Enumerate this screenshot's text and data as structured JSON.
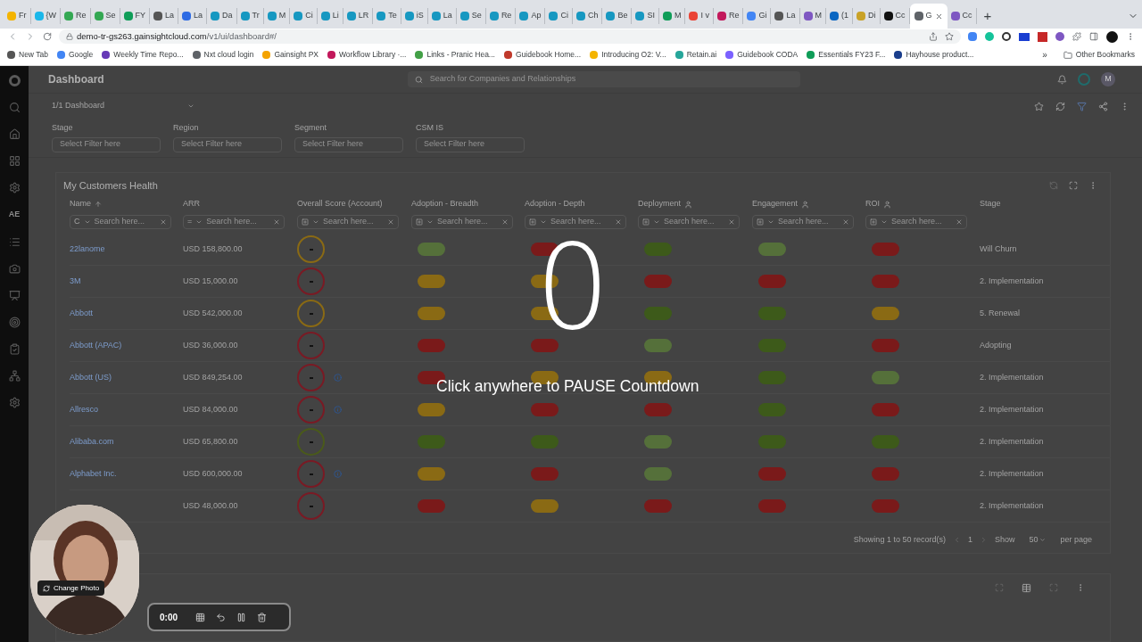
{
  "browser": {
    "tabs": [
      {
        "title": "Fr",
        "color": "#f4b400",
        "selected": false
      },
      {
        "title": "{W",
        "color": "#1ab7ea",
        "selected": false
      },
      {
        "title": "Re",
        "color": "#34a853",
        "selected": false
      },
      {
        "title": "Se",
        "color": "#34a853",
        "selected": false
      },
      {
        "title": "FY",
        "color": "#0f9d58",
        "selected": false
      },
      {
        "title": "La",
        "color": "#555555",
        "selected": false
      },
      {
        "title": "La",
        "color": "#2d6be4",
        "selected": false
      },
      {
        "title": "Da",
        "color": "#1798c1",
        "selected": false
      },
      {
        "title": "Tr",
        "color": "#1798c1",
        "selected": false
      },
      {
        "title": "M",
        "color": "#1798c1",
        "selected": false
      },
      {
        "title": "Ci",
        "color": "#1798c1",
        "selected": false
      },
      {
        "title": "Li",
        "color": "#1798c1",
        "selected": false
      },
      {
        "title": "LR",
        "color": "#1798c1",
        "selected": false
      },
      {
        "title": "Te",
        "color": "#1798c1",
        "selected": false
      },
      {
        "title": "iS",
        "color": "#1798c1",
        "selected": false
      },
      {
        "title": "La",
        "color": "#1798c1",
        "selected": false
      },
      {
        "title": "Se",
        "color": "#1798c1",
        "selected": false
      },
      {
        "title": "Re",
        "color": "#1798c1",
        "selected": false
      },
      {
        "title": "Ap",
        "color": "#1798c1",
        "selected": false
      },
      {
        "title": "Ci",
        "color": "#1798c1",
        "selected": false
      },
      {
        "title": "Ch",
        "color": "#1798c1",
        "selected": false
      },
      {
        "title": "Be",
        "color": "#1798c1",
        "selected": false
      },
      {
        "title": "SI",
        "color": "#1798c1",
        "selected": false
      },
      {
        "title": "M",
        "color": "#0f9d58",
        "selected": false
      },
      {
        "title": "I v",
        "color": "#ea4335",
        "selected": false
      },
      {
        "title": "Re",
        "color": "#c2185b",
        "selected": false
      },
      {
        "title": "Gi",
        "color": "#4285f4",
        "selected": false
      },
      {
        "title": "La",
        "color": "#555555",
        "selected": false
      },
      {
        "title": "M",
        "color": "#7e57c2",
        "selected": false
      },
      {
        "title": "(1",
        "color": "#0a66c2",
        "selected": false
      },
      {
        "title": "Di",
        "color": "#c9a227",
        "selected": false
      },
      {
        "title": "Cc",
        "color": "#111111",
        "selected": false
      },
      {
        "title": "G",
        "color": "#5f6368",
        "selected": true
      },
      {
        "title": "Cc",
        "color": "#7e57c2",
        "selected": false
      }
    ],
    "new_tab": "+",
    "url_host": "demo-tr-gs263.gainsightcloud.com",
    "url_path": "/v1/ui/dashboard#/",
    "bookmarks": [
      {
        "title": "New Tab",
        "color": "#555555"
      },
      {
        "title": "Google",
        "color": "#4285f4"
      },
      {
        "title": "Weekly Time Repo...",
        "color": "#673ab7"
      },
      {
        "title": "Nxt cloud login",
        "color": "#5f6368"
      },
      {
        "title": "Gainsight PX",
        "color": "#f4a300"
      },
      {
        "title": "Workflow Library ·...",
        "color": "#c2185b"
      },
      {
        "title": "Links - Pranic Hea...",
        "color": "#43a047"
      },
      {
        "title": "Guidebook Home...",
        "color": "#c0392b"
      },
      {
        "title": "Introducing O2: V...",
        "color": "#f4b400"
      },
      {
        "title": "Retain.ai",
        "color": "#26a69a"
      },
      {
        "title": "Guidebook CODA",
        "color": "#7b61ff"
      },
      {
        "title": "Essentials FY23 F...",
        "color": "#0f9d58"
      },
      {
        "title": "Hayhouse product...",
        "color": "#1a3e8c"
      }
    ],
    "more_bookmarks": "»",
    "other_bookmarks": "Other Bookmarks"
  },
  "app": {
    "sidebar_label": "AE",
    "page_title": "Dashboard",
    "search_placeholder": "Search for Companies and Relationships",
    "avatar": "M",
    "dashboard_select": "1/1 Dashboard",
    "filters": [
      {
        "label": "Stage",
        "placeholder": "Select Filter here"
      },
      {
        "label": "Region",
        "placeholder": "Select Filter here"
      },
      {
        "label": "Segment",
        "placeholder": "Select Filter here"
      },
      {
        "label": "CSM IS",
        "placeholder": "Select Filter here"
      }
    ],
    "card_title": "My Customers Health",
    "columns": [
      {
        "label": "Name",
        "kind": "sorted",
        "operator": "C",
        "placeholder": "Search here..."
      },
      {
        "label": "ARR",
        "kind": "plain",
        "operator": "=",
        "placeholder": "Search here..."
      },
      {
        "label": "Overall Score (Account)",
        "kind": "plain",
        "placeholder": "Search here..."
      },
      {
        "label": "Adoption - Breadth",
        "kind": "plain",
        "placeholder": "Search here..."
      },
      {
        "label": "Adoption - Depth",
        "kind": "plain",
        "placeholder": "Search here..."
      },
      {
        "label": "Deployment",
        "kind": "person",
        "placeholder": "Search here..."
      },
      {
        "label": "Engagement",
        "kind": "person",
        "placeholder": "Search here..."
      },
      {
        "label": "ROI",
        "kind": "person",
        "placeholder": "Search here..."
      },
      {
        "label": "Stage",
        "kind": "nofilter"
      }
    ],
    "rows": [
      {
        "name": "22lanome",
        "arr": "USD 158,800.00",
        "score": {
          "color": "#8a6a14"
        },
        "info": false,
        "scores": [
          {
            "color": "#55703a"
          },
          {
            "color": "#7a1a1a"
          },
          {
            "color": "#3d5a1a"
          },
          {
            "color": "#55703a"
          },
          {
            "color": "#7a1a1a"
          }
        ],
        "stage": "Will Churn"
      },
      {
        "name": "3M",
        "arr": "USD 15,000.00",
        "score": {
          "color": "#7a1a24"
        },
        "info": false,
        "scores": [
          {
            "color": "#8a6a14"
          },
          {
            "color": "#8a6a14"
          },
          {
            "color": "#7a1a1a"
          },
          {
            "color": "#7a1a1a"
          },
          {
            "color": "#7a1a1a"
          }
        ],
        "stage": "2. Implementation"
      },
      {
        "name": "Abbott",
        "arr": "USD 542,000.00",
        "score": {
          "color": "#8a6a14"
        },
        "info": false,
        "scores": [
          {
            "color": "#8a6a14"
          },
          {
            "color": "#8a6a14"
          },
          {
            "color": "#3d5a1a"
          },
          {
            "color": "#3d5a1a"
          },
          {
            "color": "#8a6a14"
          }
        ],
        "stage": "5. Renewal"
      },
      {
        "name": "Abbott (APAC)",
        "arr": "USD 36,000.00",
        "score": {
          "color": "#7a1a24"
        },
        "info": false,
        "scores": [
          {
            "color": "#7a1a1a"
          },
          {
            "color": "#7a1a1a"
          },
          {
            "color": "#55703a"
          },
          {
            "color": "#3d5a1a"
          },
          {
            "color": "#7a1a1a"
          }
        ],
        "stage": "Adopting"
      },
      {
        "name": "Abbott (US)",
        "arr": "USD 849,254.00",
        "score": {
          "color": "#7a1a24"
        },
        "info": true,
        "scores": [
          {
            "color": "#7a1a1a"
          },
          {
            "color": "#8a6a14"
          },
          {
            "color": "#8a6a14"
          },
          {
            "color": "#3d5a1a"
          },
          {
            "color": "#55703a"
          }
        ],
        "stage": "2. Implementation"
      },
      {
        "name": "Allresco",
        "arr": "USD 84,000.00",
        "score": {
          "color": "#7a1a24"
        },
        "info": true,
        "scores": [
          {
            "color": "#8a6a14"
          },
          {
            "color": "#7a1a1a"
          },
          {
            "color": "#7a1a1a"
          },
          {
            "color": "#3d5a1a"
          },
          {
            "color": "#7a1a1a"
          }
        ],
        "stage": "2. Implementation"
      },
      {
        "name": "Alibaba.com",
        "arr": "USD 65,800.00",
        "score": {
          "color": "#4a5a1a"
        },
        "info": false,
        "scores": [
          {
            "color": "#3d5a1a"
          },
          {
            "color": "#3d5a1a"
          },
          {
            "color": "#55703a"
          },
          {
            "color": "#3d5a1a"
          },
          {
            "color": "#3d5a1a"
          }
        ],
        "stage": "2. Implementation"
      },
      {
        "name": "Alphabet Inc.",
        "arr": "USD 600,000.00",
        "score": {
          "color": "#7a1a24"
        },
        "info": true,
        "scores": [
          {
            "color": "#8a6a14"
          },
          {
            "color": "#7a1a1a"
          },
          {
            "color": "#55703a"
          },
          {
            "color": "#7a1a1a"
          },
          {
            "color": "#7a1a1a"
          }
        ],
        "stage": "2. Implementation"
      },
      {
        "arr": "USD 48,000.00",
        "score": {
          "color": "#7a1a24"
        },
        "info": false,
        "scores": [
          {
            "color": "#7a1a1a"
          },
          {
            "color": "#8a6a14"
          },
          {
            "color": "#7a1a1a"
          },
          {
            "color": "#7a1a1a"
          },
          {
            "color": "#7a1a1a"
          }
        ],
        "stage": "2. Implementation"
      }
    ],
    "pagination": {
      "summary": "Showing 1 to 50 record(s)",
      "page": "1",
      "show": "Show",
      "page_size": "50",
      "per_page": "per page"
    }
  },
  "countdown": {
    "number": "0",
    "message": "Click anywhere to PAUSE Countdown"
  },
  "webcam": {
    "button": "Change Photo"
  },
  "recorder": {
    "time": "0:00"
  }
}
